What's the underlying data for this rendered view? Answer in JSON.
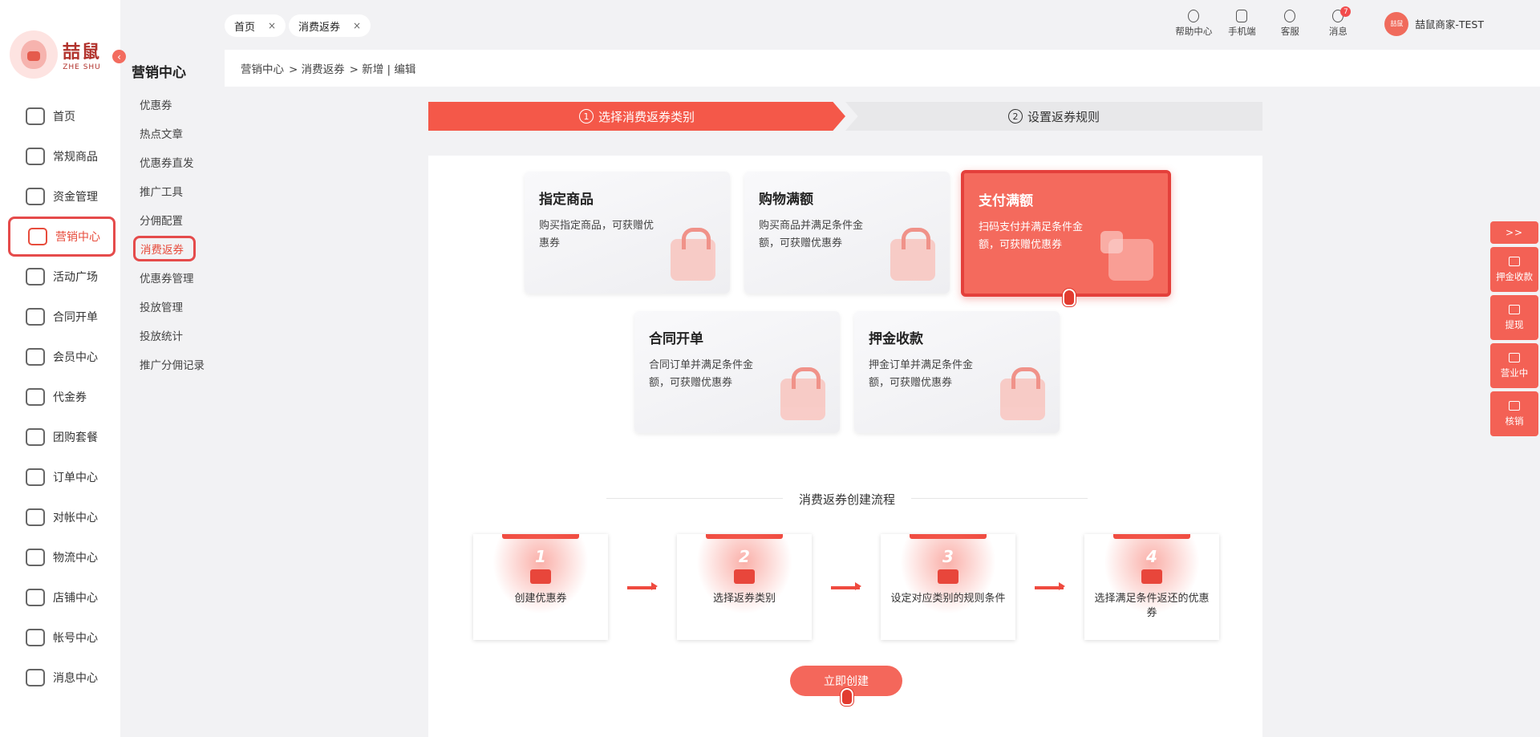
{
  "logo": {
    "cn": "喆鼠",
    "en": "ZHE SHU"
  },
  "collapse_icon": "chevron-left-icon",
  "nav": {
    "items": [
      {
        "label": "首页",
        "icon": "home-icon"
      },
      {
        "label": "常规商品",
        "icon": "cart-icon"
      },
      {
        "label": "资金管理",
        "icon": "layers-icon"
      },
      {
        "label": "营销中心",
        "icon": "megaphone-icon",
        "active": true
      },
      {
        "label": "活动广场",
        "icon": "box-icon"
      },
      {
        "label": "合同开单",
        "icon": "contract-icon"
      },
      {
        "label": "会员中心",
        "icon": "vip-card-icon"
      },
      {
        "label": "代金券",
        "icon": "voucher-icon"
      },
      {
        "label": "团购套餐",
        "icon": "group-buy-icon"
      },
      {
        "label": "订单中心",
        "icon": "order-icon"
      },
      {
        "label": "对帐中心",
        "icon": "yuan-icon"
      },
      {
        "label": "物流中心",
        "icon": "package-icon"
      },
      {
        "label": "店铺中心",
        "icon": "store-icon"
      },
      {
        "label": "帐号中心",
        "icon": "user-icon"
      },
      {
        "label": "消息中心",
        "icon": "chat-icon"
      }
    ]
  },
  "sub_nav": {
    "title": "营销中心",
    "items": [
      {
        "label": "优惠券"
      },
      {
        "label": "热点文章"
      },
      {
        "label": "优惠券直发"
      },
      {
        "label": "推广工具"
      },
      {
        "label": "分佣配置"
      },
      {
        "label": "消费返券",
        "active": true
      },
      {
        "label": "优惠券管理"
      },
      {
        "label": "投放管理"
      },
      {
        "label": "投放统计"
      },
      {
        "label": "推广分佣记录"
      }
    ]
  },
  "tabs": [
    {
      "label": "首页",
      "close": "×"
    },
    {
      "label": "消费返券",
      "close": "×"
    }
  ],
  "top_actions": [
    {
      "label": "帮助中心",
      "icon": "help-icon"
    },
    {
      "label": "手机端",
      "icon": "phone-icon"
    },
    {
      "label": "客服",
      "icon": "headset-icon"
    },
    {
      "label": "消息",
      "icon": "message-icon",
      "badge": "7"
    }
  ],
  "user": {
    "name": "喆鼠商家-TEST",
    "avatar_text": "喆鼠"
  },
  "breadcrumb": [
    "营销中心",
    "> 消费返券",
    "> 新增 | 编辑"
  ],
  "stepper": {
    "step1": {
      "num": "1",
      "label": "选择消费返券类别"
    },
    "step2": {
      "num": "2",
      "label": "设置返券规则"
    }
  },
  "cards": [
    {
      "title": "指定商品",
      "desc": "购买指定商品，可获赠优惠券",
      "icon": "shopping-bag-icon"
    },
    {
      "title": "购物满额",
      "desc": "购买商品并满足条件金额，可获赠优惠券",
      "icon": "money-bag-icon"
    },
    {
      "title": "支付满额",
      "desc": "扫码支付并满足条件金额，可获赠优惠券",
      "icon": "qr-code-icon",
      "selected": true
    },
    {
      "title": "合同开单",
      "desc": "合同订单并满足条件金额，可获赠优惠券",
      "icon": "document-icon"
    },
    {
      "title": "押金收款",
      "desc": "押金订单并满足条件金额，可获赠优惠券",
      "icon": "deposit-shield-icon"
    }
  ],
  "flow": {
    "title": "消费返券创建流程",
    "steps": [
      {
        "num": "1",
        "label": "创建优惠券",
        "icon": "coupon-plus-icon"
      },
      {
        "num": "2",
        "label": "选择返券类别",
        "icon": "coupon-list-icon"
      },
      {
        "num": "3",
        "label": "设定对应类别的规则条件",
        "icon": "coupon-rule-icon"
      },
      {
        "num": "4",
        "label": "选择满足条件返还的优惠券",
        "icon": "coupon-return-icon"
      }
    ]
  },
  "create_button": "立即创建",
  "float_tools": {
    "expand": ">>",
    "items": [
      {
        "label": "押金收款",
        "icon": "card-icon"
      },
      {
        "label": "提现",
        "icon": "withdraw-icon"
      },
      {
        "label": "营业中",
        "icon": "shop-icon"
      },
      {
        "label": "核销",
        "icon": "verify-icon"
      }
    ]
  },
  "colors": {
    "accent": "#f45849",
    "accent_dark": "#e4403b",
    "bg": "#f2f2f4"
  }
}
